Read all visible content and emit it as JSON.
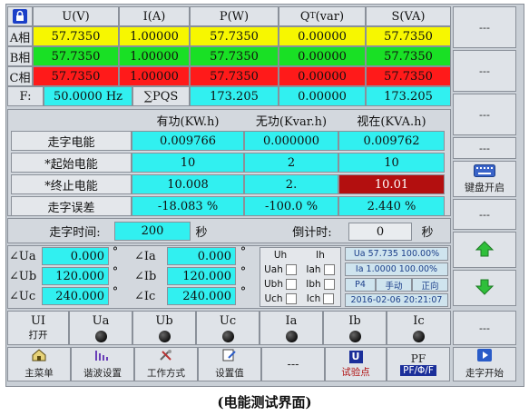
{
  "top": {
    "lock": "锁",
    "headers": [
      "U(V)",
      "I(A)",
      "P(W)",
      "Q",
      "T",
      "(var)",
      "S(VA)"
    ],
    "rows": [
      {
        "label": "A相",
        "vals": [
          "57.7350",
          "1.00000",
          "57.7350",
          "0.00000",
          "57.7350"
        ]
      },
      {
        "label": "B相",
        "vals": [
          "57.7350",
          "1.00000",
          "57.7350",
          "0.00000",
          "57.7350"
        ]
      },
      {
        "label": "C相",
        "vals": [
          "57.7350",
          "1.00000",
          "57.7350",
          "0.00000",
          "57.7350"
        ]
      }
    ],
    "f_label": "F:",
    "freq": "50.0000 Hz",
    "pqs_label": "∑PQS",
    "sum": [
      "173.205",
      "0.00000",
      "173.205"
    ]
  },
  "energy": {
    "headers": [
      "有功(KW.h)",
      "无功(Kvar.h)",
      "视在(KVA.h)"
    ],
    "rows": [
      {
        "label": "走字电能",
        "vals": [
          "0.009766",
          "0.000000",
          "0.009762"
        ]
      },
      {
        "label": "*起始电能",
        "vals": [
          "10",
          "2",
          "10"
        ]
      },
      {
        "label": "*终止电能",
        "vals": [
          "10.008",
          "2.",
          "10.01"
        ]
      },
      {
        "label": "走字误差",
        "vals": [
          "-18.083 %",
          "-100.0 %",
          "2.440 %"
        ]
      }
    ],
    "time_label": "走字时间:",
    "time_val": "200",
    "time_unit": "秒",
    "countdown_label": "倒计时:",
    "countdown_val": "0",
    "countdown_unit": "秒"
  },
  "angles": {
    "u": [
      {
        "label": "∠Ua",
        "val": "0.000"
      },
      {
        "label": "∠Ub",
        "val": "120.000"
      },
      {
        "label": "∠Uc",
        "val": "240.000"
      }
    ],
    "i": [
      {
        "label": "∠Ia",
        "val": "0.000"
      },
      {
        "label": "∠Ib",
        "val": "120.000"
      },
      {
        "label": "∠Ic",
        "val": "240.000"
      }
    ],
    "deg": "°"
  },
  "harm": {
    "labels": [
      "Uh",
      "Ih",
      "Uah",
      "Iah",
      "Ubh",
      "Ibh",
      "Uch",
      "Ich"
    ]
  },
  "info": {
    "line1": "Ua 57.735 100.00%",
    "line2": "Ia 1.0000 100.00%",
    "p4": "P4",
    "manual": "手动",
    "direction": "正向",
    "datetime": "2016-02-06 20:21:07"
  },
  "signals": [
    {
      "label": "UI",
      "sub": "打开"
    },
    {
      "label": "Ua"
    },
    {
      "label": "Ub"
    },
    {
      "label": "Uc"
    },
    {
      "label": "Ia"
    },
    {
      "label": "Ib"
    },
    {
      "label": "Ic"
    }
  ],
  "right_buttons": [
    "---",
    "---",
    "---",
    "---",
    "---",
    "键盘开启",
    "---"
  ],
  "menu": [
    {
      "label": "主菜单"
    },
    {
      "label": "谐波设置"
    },
    {
      "label": "工作方式"
    },
    {
      "label": "设置值"
    },
    {
      "label": "---"
    },
    {
      "label": "试验点",
      "glyph": "U"
    },
    {
      "label": "PF/Φ/F",
      "glyph": "PF"
    },
    {
      "label": "走字开始"
    }
  ],
  "caption": "(电能测试界面)"
}
